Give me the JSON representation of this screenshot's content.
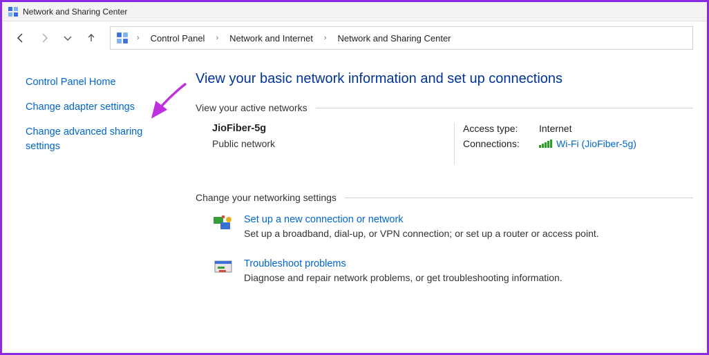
{
  "window": {
    "title": "Network and Sharing Center"
  },
  "breadcrumb": {
    "items": [
      "Control Panel",
      "Network and Internet",
      "Network and Sharing Center"
    ]
  },
  "sidebar": {
    "home": "Control Panel Home",
    "adapter": "Change adapter settings",
    "advanced": "Change advanced sharing settings"
  },
  "main": {
    "heading": "View your basic network information and set up connections",
    "active_section": "View your active networks",
    "network": {
      "name": "JioFiber-5g",
      "category": "Public network",
      "access_label": "Access type:",
      "access_value": "Internet",
      "connections_label": "Connections:",
      "connection_name": "Wi-Fi (JioFiber-5g)"
    },
    "settings_section": "Change your networking settings",
    "setup": {
      "title": "Set up a new connection or network",
      "desc": "Set up a broadband, dial-up, or VPN connection; or set up a router or access point."
    },
    "troubleshoot": {
      "title": "Troubleshoot problems",
      "desc": "Diagnose and repair network problems, or get troubleshooting information."
    }
  }
}
